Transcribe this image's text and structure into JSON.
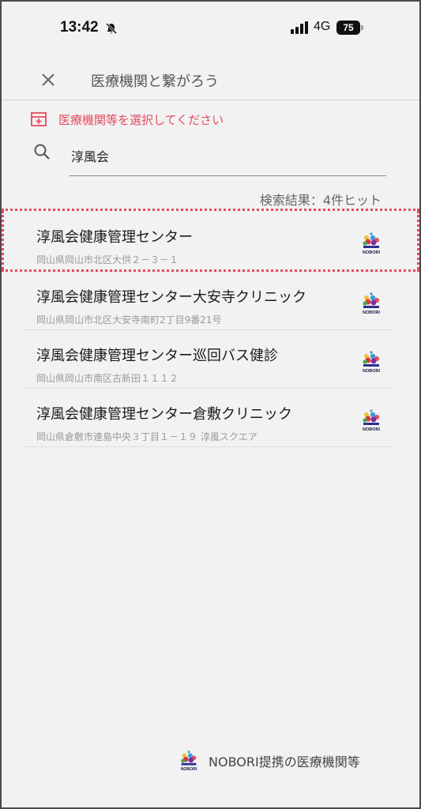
{
  "status": {
    "time": "13:42",
    "network": "4G",
    "battery": "75"
  },
  "header": {
    "title": "医療機関と繋がろう"
  },
  "prompt": {
    "text": "医療機関等を選択してください"
  },
  "search": {
    "value": "淳風会"
  },
  "results": {
    "count_text": "検索結果：4件ヒット",
    "items": [
      {
        "name": "淳風会健康管理センター",
        "address": "岡山県岡山市北区大供２－３－１",
        "logo_text": "NOBORI"
      },
      {
        "name": "淳風会健康管理センター大安寺クリニック",
        "address": "岡山県岡山市北区大安寺南町2丁目9番21号",
        "logo_text": "NOBORI"
      },
      {
        "name": "淳風会健康管理センター巡回バス健診",
        "address": "岡山県岡山市南区古新田１１１２",
        "logo_text": "NOBORI"
      },
      {
        "name": "淳風会健康管理センター倉敷クリニック",
        "address": "岡山県倉敷市連島中央３丁目１－１９ 淳風スクエア",
        "logo_text": "NOBORI"
      }
    ]
  },
  "footer": {
    "label": "NOBORI提携の医療機関等",
    "logo_text": "NOBORI"
  },
  "colors": {
    "accent": "#e34c60",
    "background": "#f2f2f2"
  }
}
